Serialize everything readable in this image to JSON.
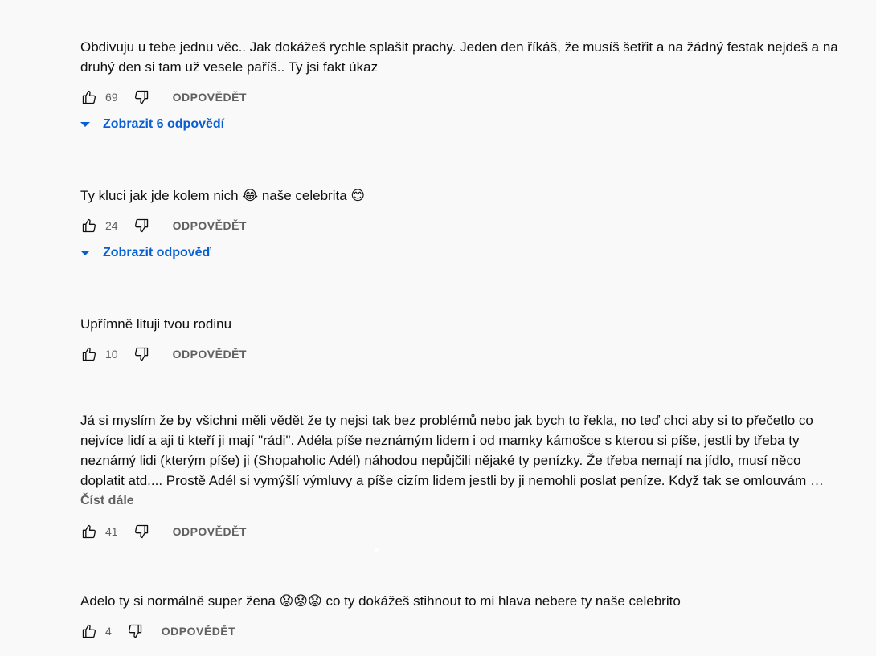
{
  "comments": [
    {
      "text": "Obdivuju u tebe jednu věc.. Jak dokážeš rychle splašit prachy. Jeden den říkáš, že musíš šetřit a na žádný festak nejdeš a na druhý den si tam už vesele paříš.. Ty jsi fakt úkaz",
      "likes": "69",
      "reply_label": "ODPOVĚDĚT",
      "replies_label": "Zobrazit 6 odpovědí"
    },
    {
      "text": "Ty kluci jak jde kolem nich 😂 naše celebrita 😊",
      "likes": "24",
      "reply_label": "ODPOVĚDĚT",
      "replies_label": "Zobrazit odpověď"
    },
    {
      "text": "Upřímně lituji tvou rodinu",
      "likes": "10",
      "reply_label": "ODPOVĚDĚT"
    },
    {
      "text": "Já si myslím že by všichni měli vědět že ty nejsi tak bez problémů nebo jak bych to řekla, no teď chci aby si to přečetlo co nejvíce lidí a aji ti kteří ji mají \"rádi\". Adéla píše neznámým lidem i od mamky kámošce s kterou si píše, jestli by třeba ty neznámý lidi (kterým píše) ji (Shopaholic Adél) náhodou nepůjčili nějaké ty penízky. Že třeba nemají na jídlo, musí něco doplatit atd.... Prostě Adél si vymýšlí výmluvy a píše cizím lidem jestli by ji nemohli poslat peníze. Když tak se omlouvám …",
      "read_more": "Číst dále",
      "likes": "41",
      "reply_label": "ODPOVĚDĚT"
    },
    {
      "text": "Adelo ty si normálně super žena 😟😟😟 co ty dokážeš stihnout to mi hlava nebere ty naše celebrito",
      "likes": "4",
      "reply_label": "ODPOVĚDĚT"
    }
  ],
  "icons": {
    "like": "thumbs-up-icon",
    "dislike": "thumbs-down-icon",
    "expand": "caret-down-icon"
  },
  "colors": {
    "background": "#f9f9f9",
    "link_blue": "#065fd4",
    "secondary_text": "#606060"
  }
}
